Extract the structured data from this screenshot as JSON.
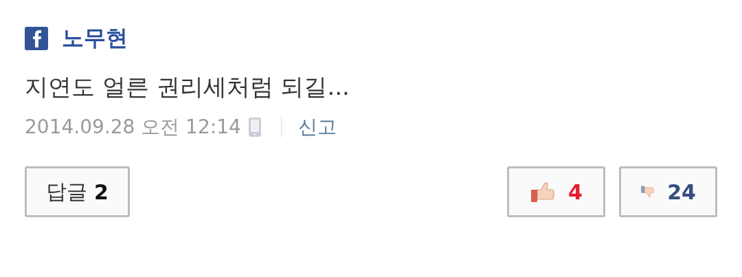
{
  "author": {
    "name": "노무현"
  },
  "comment": "지연도 얼른 권리세처럼 되길...",
  "meta": {
    "date": "2014.09.28 오전 12:14",
    "report": "신고"
  },
  "reply_button": {
    "label": "답글",
    "count": "2"
  },
  "votes": [
    {
      "kind": "like",
      "count": "4"
    },
    {
      "kind": "dislike",
      "count": "24"
    }
  ]
}
